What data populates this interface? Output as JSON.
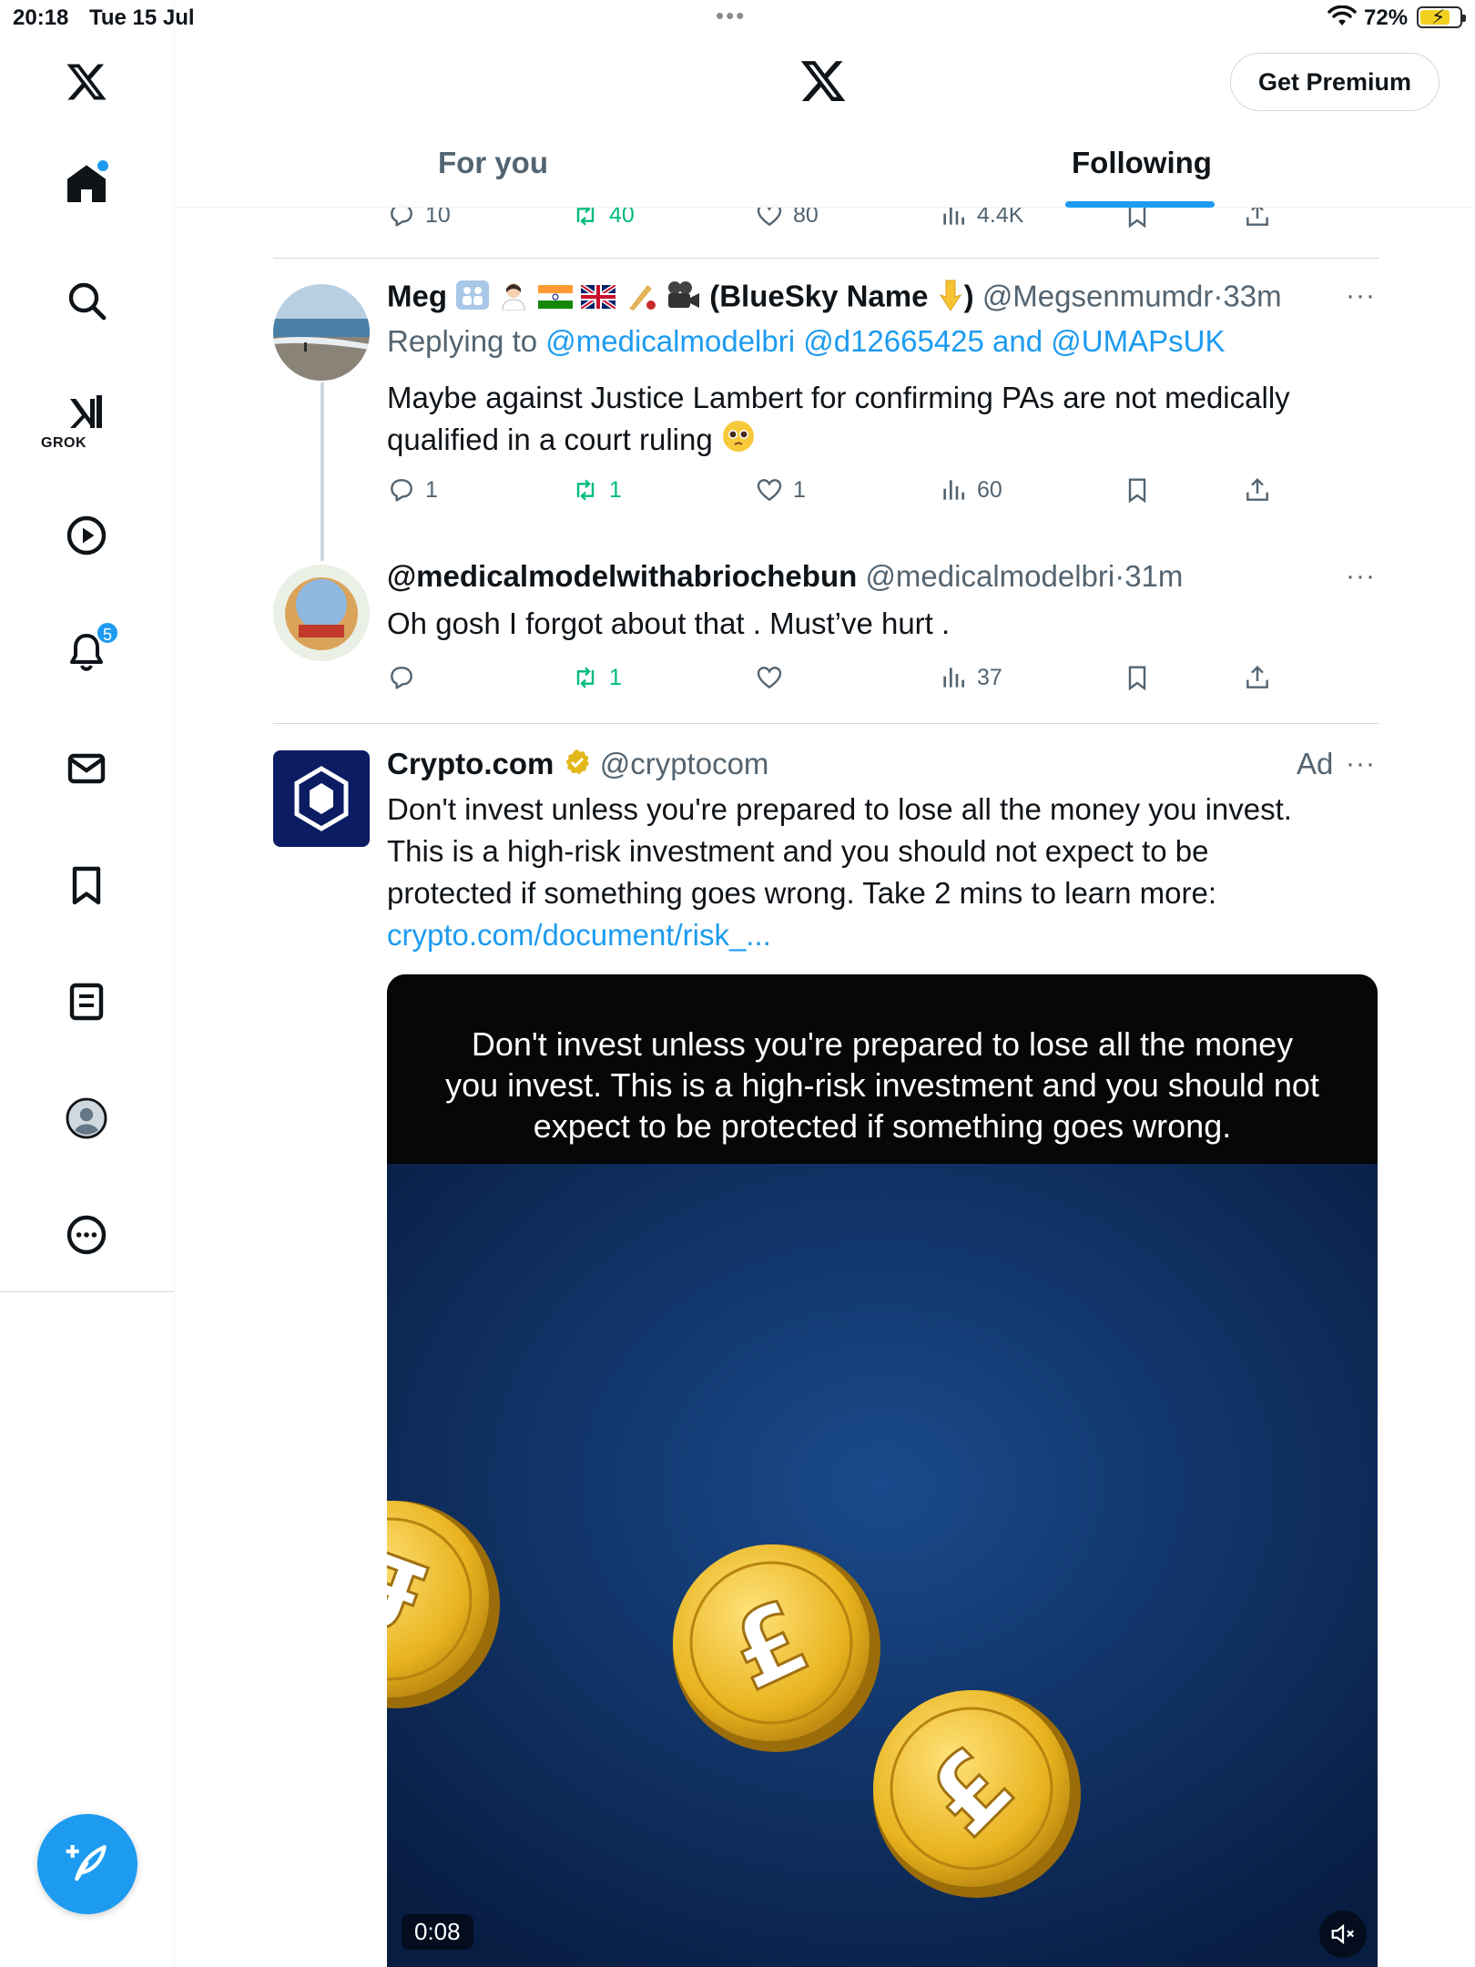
{
  "status_bar": {
    "time": "20:18",
    "date": "Tue 15 Jul",
    "battery": "72%"
  },
  "sidebar": {
    "items": [
      {
        "name": "home"
      },
      {
        "name": "search"
      },
      {
        "name": "grok",
        "label": "GROK"
      },
      {
        "name": "videos"
      },
      {
        "name": "notifications",
        "badge": "5"
      },
      {
        "name": "messages"
      },
      {
        "name": "bookmarks"
      },
      {
        "name": "lists"
      },
      {
        "name": "profile"
      },
      {
        "name": "more"
      }
    ]
  },
  "header": {
    "premium_label": "Get Premium",
    "tabs": [
      {
        "label": "For you",
        "active": false
      },
      {
        "label": "Following",
        "active": true
      }
    ]
  },
  "partial_tweet": {
    "replies": "10",
    "retweets": "40",
    "likes": "80",
    "views": "4.4K"
  },
  "tweets": [
    {
      "name": "Meg",
      "name_suffix": "(BlueSky Name",
      "name_end": ")",
      "handle": "@Megsenmumdr",
      "time": "33m",
      "replying_prefix": "Replying to",
      "replying_to": "@medicalmodelbri @d12665425 and @UMAPsUK",
      "text_line1": "Maybe against Justice Lambert for confirming PAs are not medically",
      "text_line2": "qualified in a court ruling",
      "replies": "1",
      "retweets": "1",
      "likes": "1",
      "views": "60"
    },
    {
      "name": "@medicalmodelwithabriochebun",
      "handle": "@medicalmodelbri",
      "time": "31m",
      "text": "Oh gosh I forgot about that . Must’ve hurt .",
      "replies": "",
      "retweets": "1",
      "likes": "",
      "views": "37"
    }
  ],
  "ad": {
    "name": "Crypto.com",
    "handle": "@cryptocom",
    "ad_label": "Ad",
    "text_line1": "Don't invest unless you're prepared to lose all the money you invest.",
    "text_line2": "This is a high-risk investment and you should not expect to be",
    "text_line3": "protected if something goes wrong. Take 2 mins to learn more:",
    "link": "crypto.com/document/risk_...",
    "media_caption": "Don't invest unless you're prepared to lose all the money you invest. This is a high-risk investment and you should not expect to be protected if something goes wrong.",
    "video_time": "0:08",
    "coin_symbol": "£"
  },
  "colors": {
    "accent": "#1d9bf0",
    "retweet": "#00ba7c",
    "text": "#0f1419",
    "secondary": "#536471"
  }
}
